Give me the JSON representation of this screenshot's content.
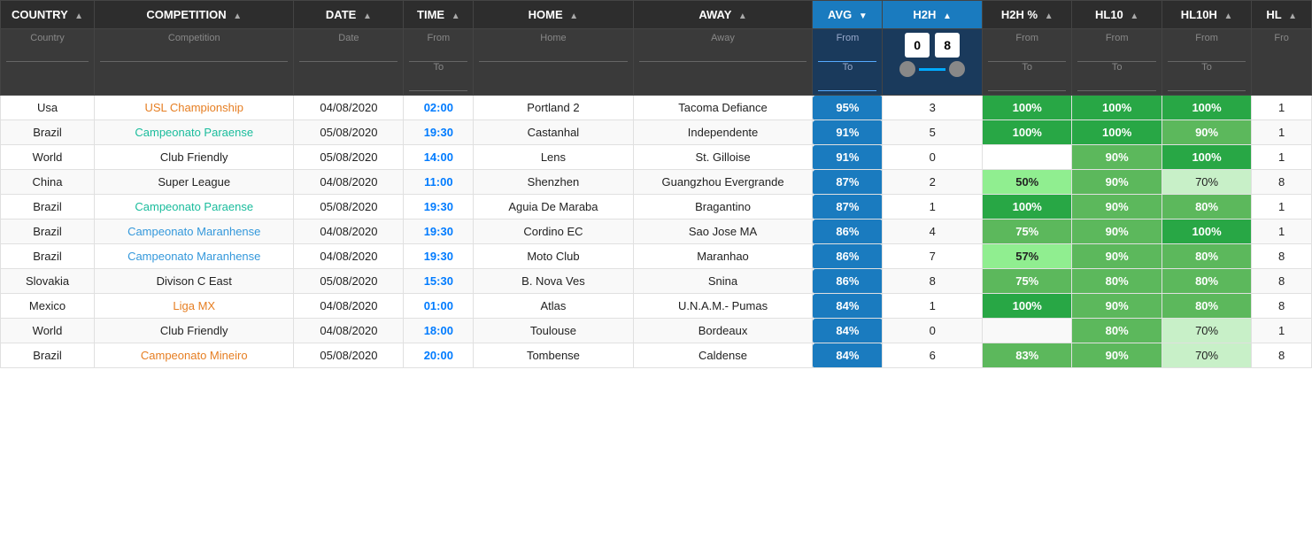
{
  "columns": [
    {
      "id": "country",
      "label": "COUNTRY",
      "class": "col-country"
    },
    {
      "id": "competition",
      "label": "COMPETITION",
      "class": "col-comp"
    },
    {
      "id": "date",
      "label": "DATE",
      "class": "col-date"
    },
    {
      "id": "time",
      "label": "TIME",
      "class": "col-time"
    },
    {
      "id": "home",
      "label": "HOME",
      "class": "col-home"
    },
    {
      "id": "away",
      "label": "AWAY",
      "class": "col-away"
    },
    {
      "id": "avg",
      "label": "AVG",
      "class": "col-avg"
    },
    {
      "id": "h2h",
      "label": "H2H",
      "class": "col-h2h"
    },
    {
      "id": "h2hpct",
      "label": "H2H %",
      "class": "col-h2hpct"
    },
    {
      "id": "hl10",
      "label": "HL10",
      "class": "col-hl10"
    },
    {
      "id": "hl10h",
      "label": "HL10H",
      "class": "col-hl10h"
    },
    {
      "id": "hl",
      "label": "HL",
      "class": "col-hl"
    }
  ],
  "filter": {
    "from_label": "From",
    "to_label": "To",
    "h2h_min": "0",
    "h2h_max": "8"
  },
  "rows": [
    {
      "country": "Usa",
      "competition": "USL Championship",
      "date": "04/08/2020",
      "time": "02:00",
      "home": "Portland 2",
      "away": "Tacoma Defiance",
      "avg": "95%",
      "h2h": 3,
      "h2hpct": "100%",
      "hl10": "100%",
      "hl10h": "100%",
      "hl": "1",
      "comp_class": "comp-orange",
      "h2hpct_class": "green-dark",
      "hl10_class": "green-dark",
      "hl10h_class": "green-dark"
    },
    {
      "country": "Brazil",
      "competition": "Campeonato Paraense",
      "date": "05/08/2020",
      "time": "19:30",
      "home": "Castanhal",
      "away": "Independente",
      "avg": "91%",
      "h2h": 5,
      "h2hpct": "100%",
      "hl10": "100%",
      "hl10h": "90%",
      "hl": "1",
      "comp_class": "comp-teal",
      "h2hpct_class": "green-dark",
      "hl10_class": "green-dark",
      "hl10h_class": "green-mid"
    },
    {
      "country": "World",
      "competition": "Club Friendly",
      "date": "05/08/2020",
      "time": "14:00",
      "home": "Lens",
      "away": "St. Gilloise",
      "avg": "91%",
      "h2h": 0,
      "h2hpct": "",
      "hl10": "90%",
      "hl10h": "100%",
      "hl": "1",
      "comp_class": "",
      "h2hpct_class": "",
      "hl10_class": "green-mid",
      "hl10h_class": "green-dark"
    },
    {
      "country": "China",
      "competition": "Super League",
      "date": "04/08/2020",
      "time": "11:00",
      "home": "Shenzhen",
      "away": "Guangzhou Evergrande",
      "avg": "87%",
      "h2h": 2,
      "h2hpct": "50%",
      "hl10": "90%",
      "hl10h": "70%",
      "hl": "8",
      "comp_class": "",
      "h2hpct_class": "green-light",
      "hl10_class": "green-mid",
      "hl10h_class": "green-pale"
    },
    {
      "country": "Brazil",
      "competition": "Campeonato Paraense",
      "date": "05/08/2020",
      "time": "19:30",
      "home": "Aguia De Maraba",
      "away": "Bragantino",
      "avg": "87%",
      "h2h": 1,
      "h2hpct": "100%",
      "hl10": "90%",
      "hl10h": "80%",
      "hl": "1",
      "comp_class": "comp-teal",
      "h2hpct_class": "green-dark",
      "hl10_class": "green-mid",
      "hl10h_class": "green-mid"
    },
    {
      "country": "Brazil",
      "competition": "Campeonato Maranhense",
      "date": "04/08/2020",
      "time": "19:30",
      "home": "Cordino EC",
      "away": "Sao Jose MA",
      "avg": "86%",
      "h2h": 4,
      "h2hpct": "75%",
      "hl10": "90%",
      "hl10h": "100%",
      "hl": "1",
      "comp_class": "comp-blue",
      "h2hpct_class": "green-mid",
      "hl10_class": "green-mid",
      "hl10h_class": "green-dark"
    },
    {
      "country": "Brazil",
      "competition": "Campeonato Maranhense",
      "date": "04/08/2020",
      "time": "19:30",
      "home": "Moto Club",
      "away": "Maranhao",
      "avg": "86%",
      "h2h": 7,
      "h2hpct": "57%",
      "hl10": "90%",
      "hl10h": "80%",
      "hl": "8",
      "comp_class": "comp-blue",
      "h2hpct_class": "green-light",
      "hl10_class": "green-mid",
      "hl10h_class": "green-mid"
    },
    {
      "country": "Slovakia",
      "competition": "Divison C East",
      "date": "05/08/2020",
      "time": "15:30",
      "home": "B. Nova Ves",
      "away": "Snina",
      "avg": "86%",
      "h2h": 8,
      "h2hpct": "75%",
      "hl10": "80%",
      "hl10h": "80%",
      "hl": "8",
      "comp_class": "",
      "h2hpct_class": "green-mid",
      "hl10_class": "green-mid",
      "hl10h_class": "green-mid"
    },
    {
      "country": "Mexico",
      "competition": "Liga MX",
      "date": "04/08/2020",
      "time": "01:00",
      "home": "Atlas",
      "away": "U.N.A.M.- Pumas",
      "avg": "84%",
      "h2h": 1,
      "h2hpct": "100%",
      "hl10": "90%",
      "hl10h": "80%",
      "hl": "8",
      "comp_class": "comp-orange",
      "h2hpct_class": "green-dark",
      "hl10_class": "green-mid",
      "hl10h_class": "green-mid"
    },
    {
      "country": "World",
      "competition": "Club Friendly",
      "date": "04/08/2020",
      "time": "18:00",
      "home": "Toulouse",
      "away": "Bordeaux",
      "avg": "84%",
      "h2h": 0,
      "h2hpct": "",
      "hl10": "80%",
      "hl10h": "70%",
      "hl": "1",
      "comp_class": "",
      "h2hpct_class": "",
      "hl10_class": "green-mid",
      "hl10h_class": "green-pale"
    },
    {
      "country": "Brazil",
      "competition": "Campeonato Mineiro",
      "date": "05/08/2020",
      "time": "20:00",
      "home": "Tombense",
      "away": "Caldense",
      "avg": "84%",
      "h2h": 6,
      "h2hpct": "83%",
      "hl10": "90%",
      "hl10h": "70%",
      "hl": "8",
      "comp_class": "comp-orange",
      "h2hpct_class": "green-mid",
      "hl10_class": "green-mid",
      "hl10h_class": "green-pale"
    }
  ]
}
